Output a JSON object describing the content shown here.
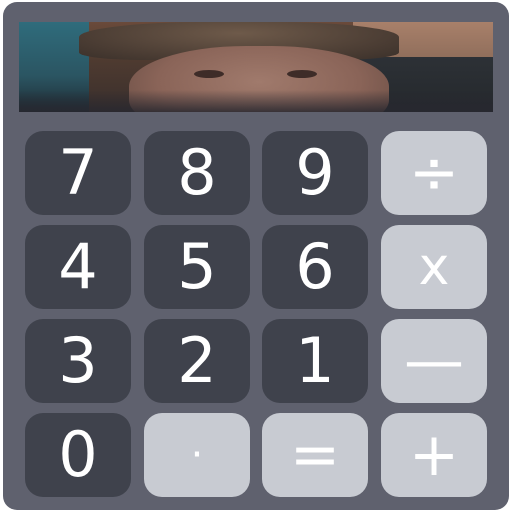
{
  "keypad": {
    "row1": {
      "k7": "7",
      "k8": "8",
      "k9": "9",
      "divide": "÷"
    },
    "row2": {
      "k4": "4",
      "k5": "5",
      "k6": "6",
      "multiply": "x"
    },
    "row3": {
      "k3": "3",
      "k2": "2",
      "k1": "1",
      "subtract": "—"
    },
    "row4": {
      "k0": "0",
      "decimal": "·",
      "equals": "=",
      "add": "+"
    }
  },
  "colors": {
    "body": "#5f616e",
    "number_key": "#3f424c",
    "operator_key": "#c8cbd2",
    "key_text": "#ffffff"
  },
  "display": {
    "content": "camera-photo"
  }
}
